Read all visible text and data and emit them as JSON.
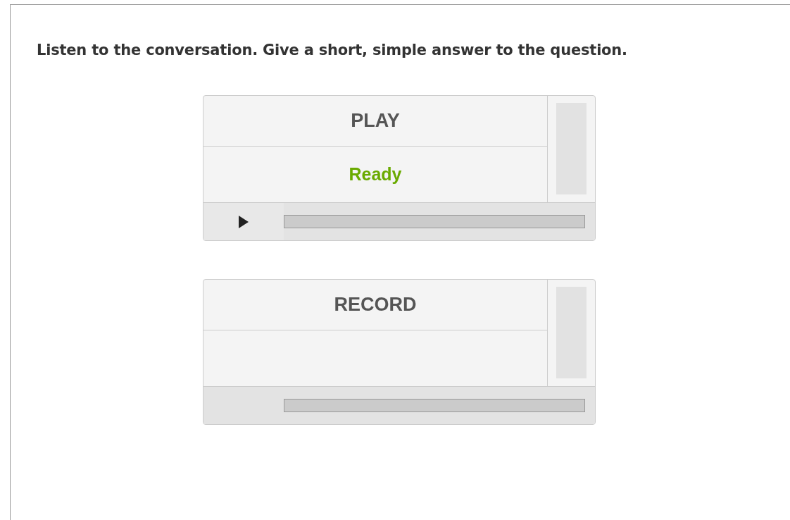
{
  "instruction": "Listen to the conversation. Give a short, simple answer to the question.",
  "panels": [
    {
      "kind": "play",
      "title": "PLAY",
      "status": "Ready",
      "progress": {
        "level": 0
      },
      "meter": {
        "level": 0
      }
    },
    {
      "kind": "record",
      "title": "RECORD",
      "progress": {
        "level": 0
      },
      "meter": {
        "level": 0
      }
    }
  ]
}
